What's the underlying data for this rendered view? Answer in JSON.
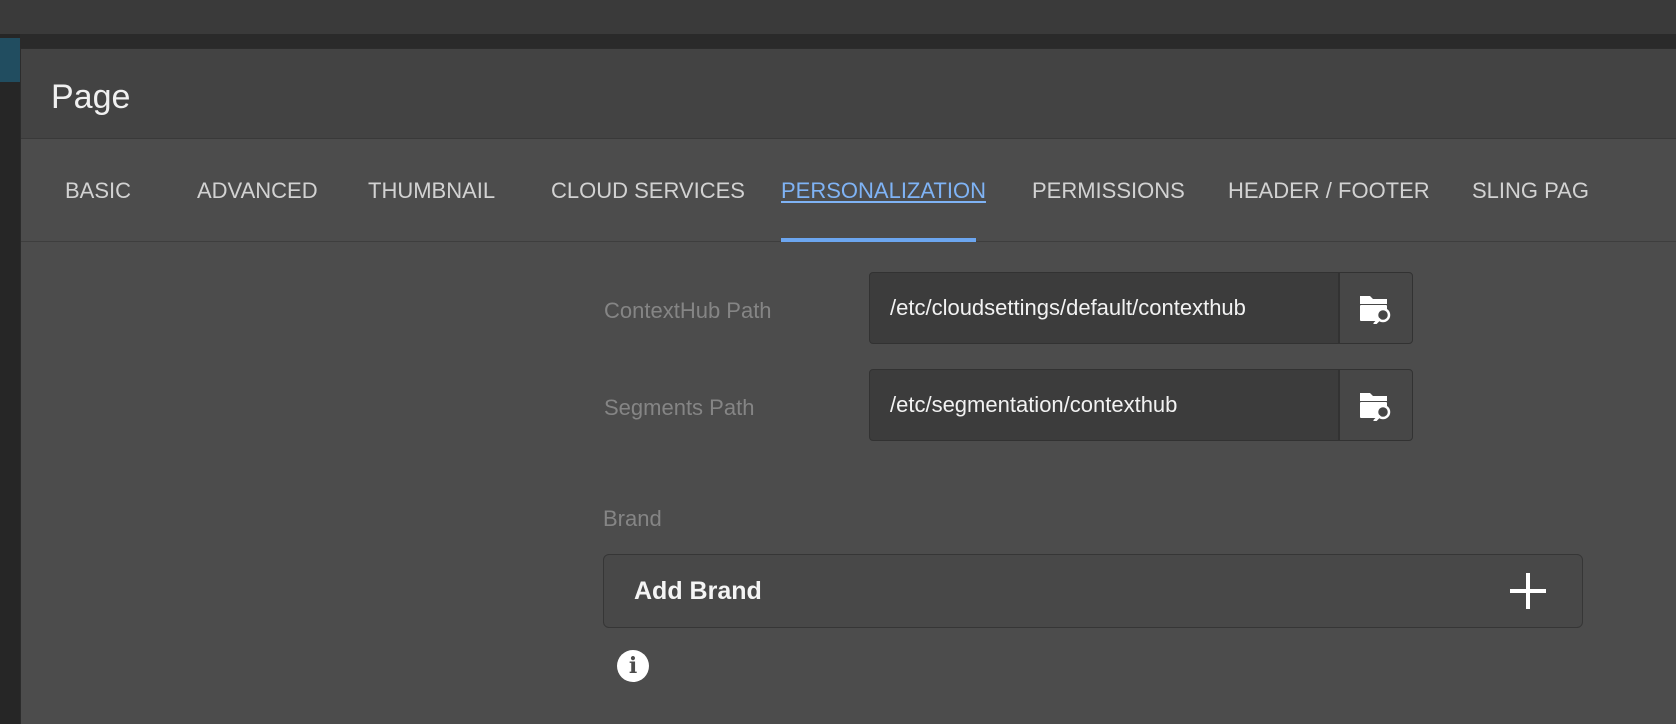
{
  "dialog": {
    "title": "Page"
  },
  "tabs": [
    {
      "label": "BASIC",
      "active": false
    },
    {
      "label": "ADVANCED",
      "active": false
    },
    {
      "label": "THUMBNAIL",
      "active": false
    },
    {
      "label": "CLOUD SERVICES",
      "active": false
    },
    {
      "label": "PERSONALIZATION",
      "active": true
    },
    {
      "label": "PERMISSIONS",
      "active": false
    },
    {
      "label": "HEADER / FOOTER",
      "active": false
    },
    {
      "label": "SLING PAG",
      "active": false
    }
  ],
  "fields": {
    "contexthub": {
      "label": "ContextHub Path",
      "value": "/etc/cloudsettings/default/contexthub",
      "picker_icon": "folder-search-icon"
    },
    "segments": {
      "label": "Segments Path",
      "value": "/etc/segmentation/contexthub",
      "picker_icon": "folder-search-icon"
    }
  },
  "brand": {
    "label": "Brand",
    "add_label": "Add Brand",
    "add_icon": "plus-icon",
    "info_icon": "info-icon",
    "info_glyph": "i"
  },
  "colors": {
    "accent": "#6ca6f0",
    "dialog_bg": "#4c4c4c",
    "header_bg": "#434343"
  }
}
